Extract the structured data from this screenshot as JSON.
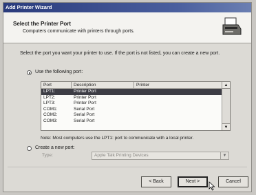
{
  "window": {
    "title": "Add Printer Wizard"
  },
  "header": {
    "title": "Select the Printer Port",
    "subtitle": "Computers communicate with printers through ports."
  },
  "instructions": "Select the port you want your printer to use. If the port is not listed, you can create a new port.",
  "option_existing": {
    "label": "Use the following port:",
    "selected": true
  },
  "port_list": {
    "columns": [
      "Port",
      "Description",
      "Printer"
    ],
    "rows": [
      {
        "port": "LPT1:",
        "description": "Printer Port",
        "printer": "",
        "selected": true
      },
      {
        "port": "LPT2:",
        "description": "Printer Port",
        "printer": ""
      },
      {
        "port": "LPT3:",
        "description": "Printer Port",
        "printer": ""
      },
      {
        "port": "COM1:",
        "description": "Serial Port",
        "printer": ""
      },
      {
        "port": "COM2:",
        "description": "Serial Port",
        "printer": ""
      },
      {
        "port": "COM3:",
        "description": "Serial Port",
        "printer": ""
      }
    ]
  },
  "note": "Note: Most computers use the LPT1: port to communicate with a local printer.",
  "option_new": {
    "label": "Create a new port:",
    "selected": false
  },
  "new_port_type": {
    "label": "Type:",
    "value": "Apple Talk Printing Devices"
  },
  "buttons": {
    "back": "< Back",
    "next": "Next >",
    "cancel": "Cancel"
  }
}
